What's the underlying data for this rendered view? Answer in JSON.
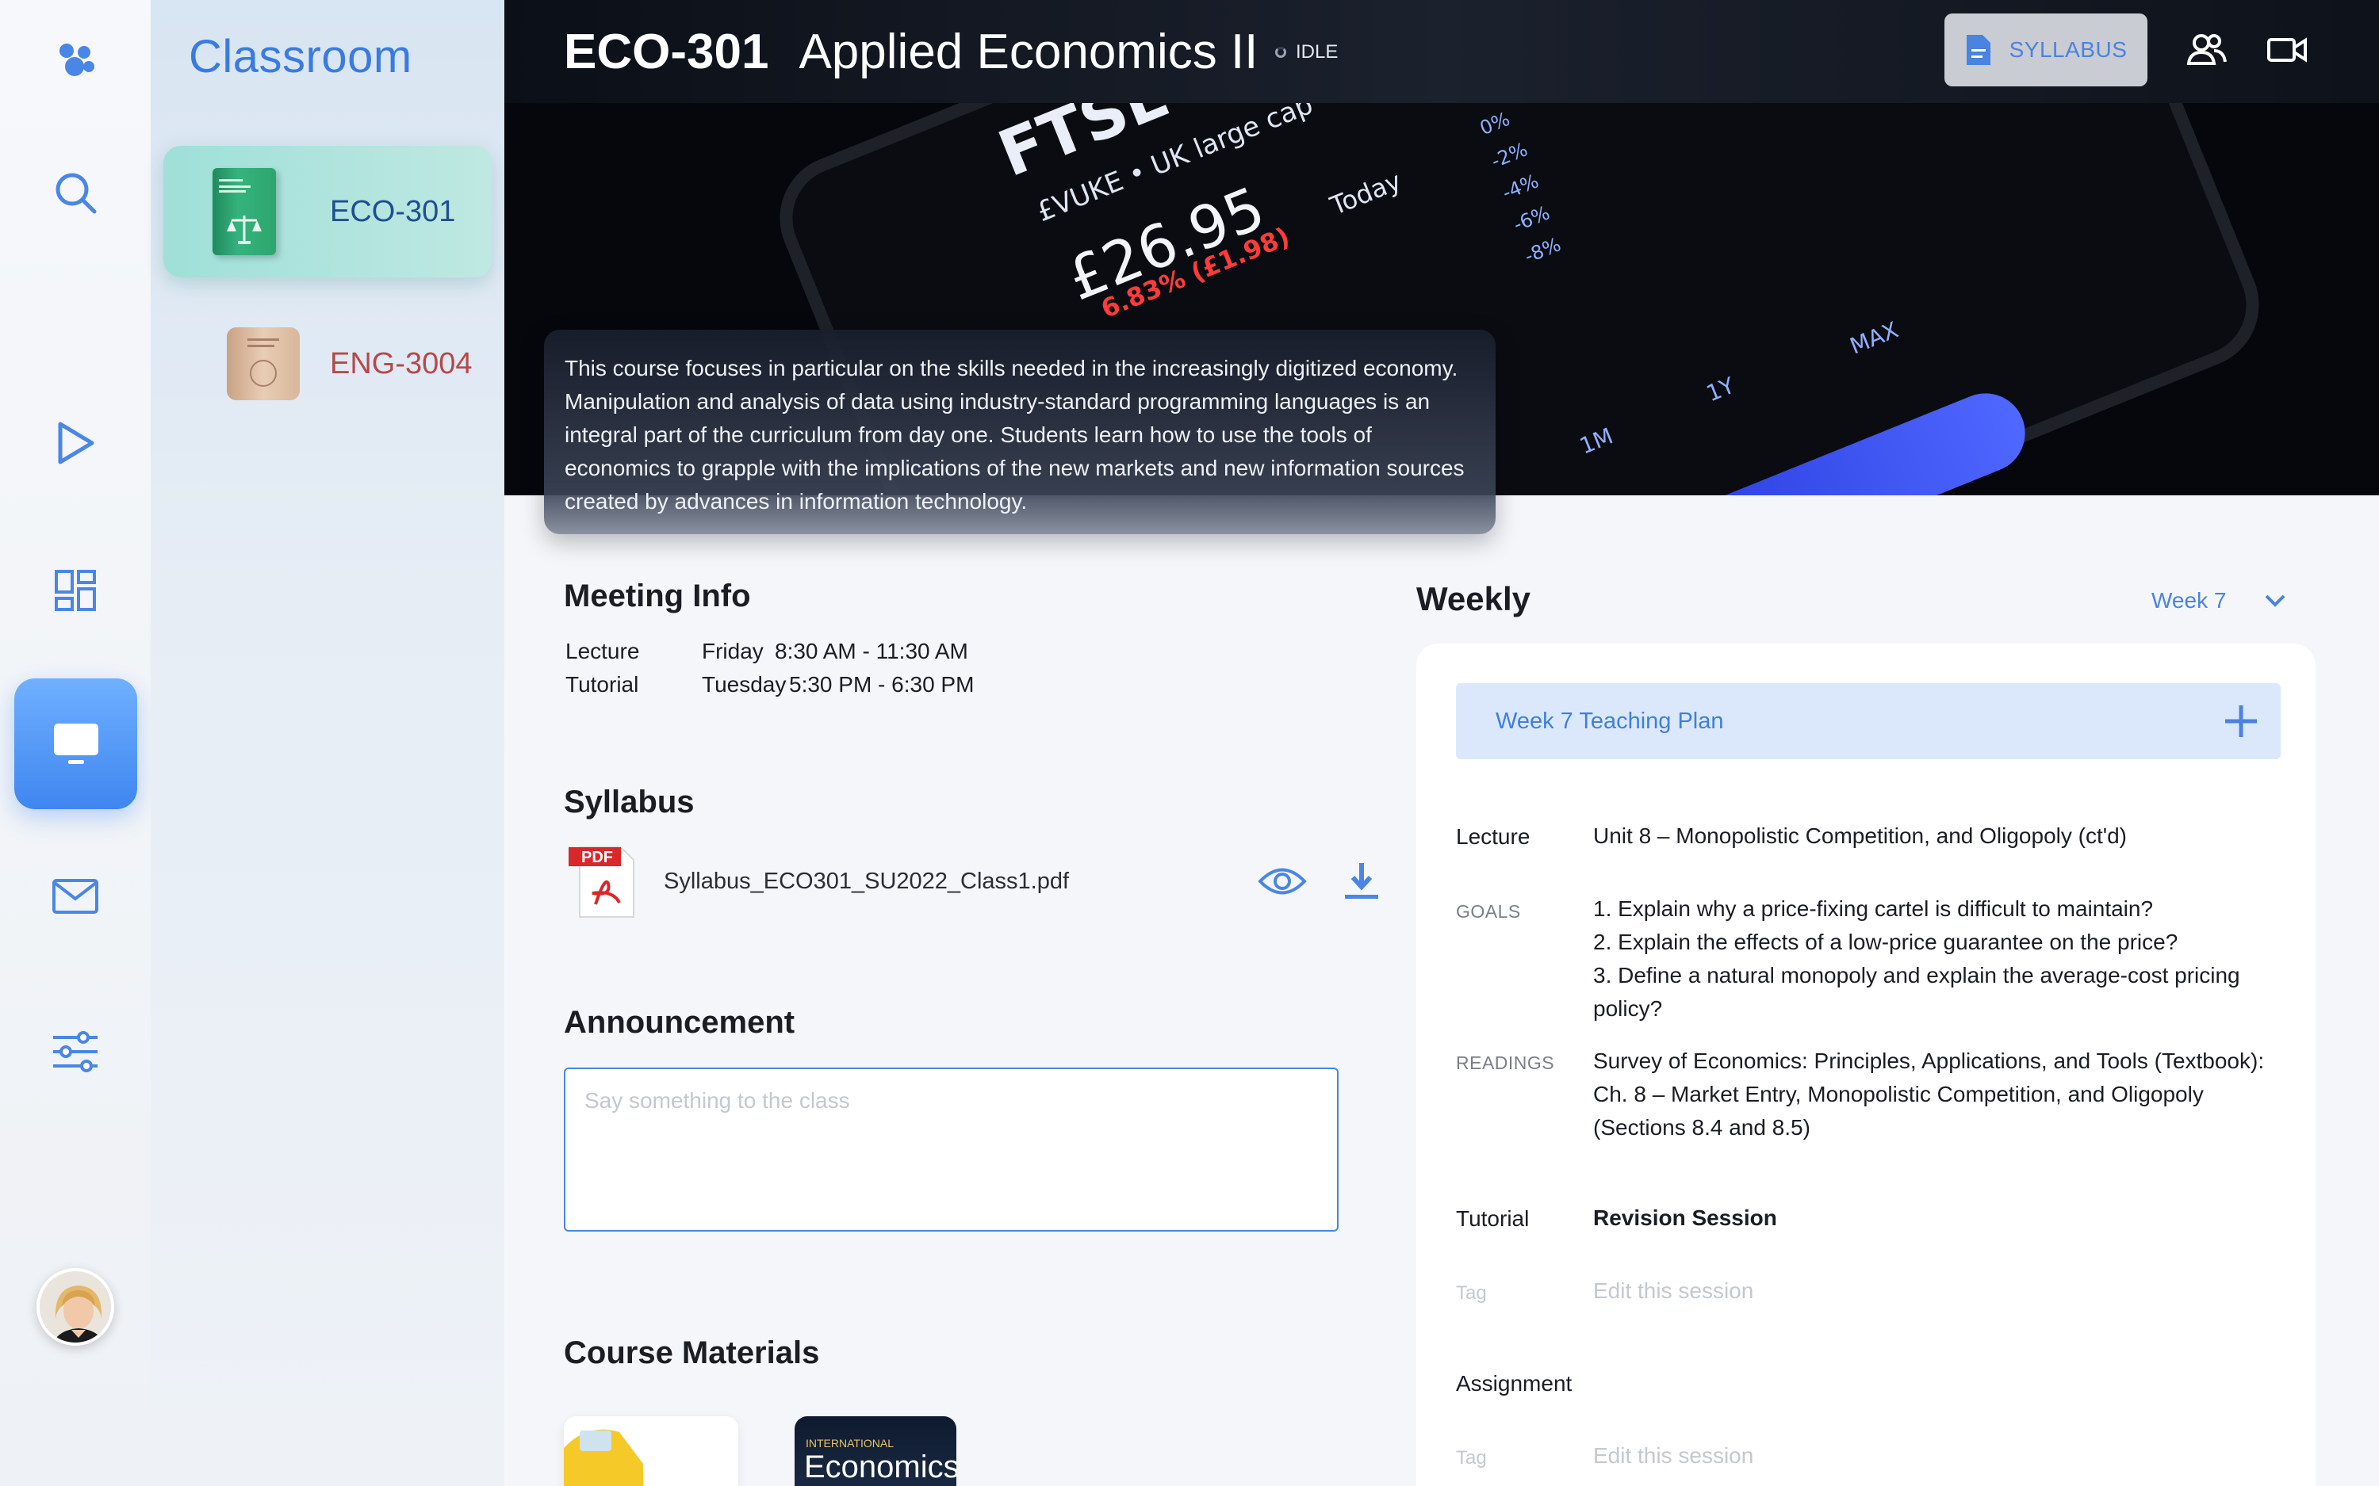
{
  "app": {
    "name": "Classroom"
  },
  "rail": {
    "items": [
      "logo-icon",
      "search-icon",
      "play-icon",
      "dashboard-icon",
      "classroom-icon",
      "mail-icon",
      "settings-sliders-icon"
    ],
    "active": "classroom-icon"
  },
  "courses": [
    {
      "code": "ECO-301",
      "active": true,
      "color": "#1f4f8f"
    },
    {
      "code": "ENG-3004",
      "active": false,
      "color": "#b44a4a"
    }
  ],
  "header": {
    "code": "ECO-301",
    "title": "Applied Economics II",
    "status": "IDLE",
    "syllabus_label": "SYLLABUS"
  },
  "hero": {
    "ticker_name": "FTSE",
    "ticker_sub": "£VUKE • UK large cap",
    "price": "£26.95",
    "change": "6.83% (£1.98)",
    "change_period": "Today",
    "percent_ticks": [
      "0%",
      "-2%",
      "-4%",
      "-6%",
      "-8%"
    ],
    "range_tabs": [
      "1M",
      "1Y",
      "MAX"
    ],
    "description": "This course focuses in particular on the skills needed in the increasingly digitized economy. Manipulation and analysis of data using industry-standard programming languages is an integral part of the curriculum from day one. Students learn how to use the tools of economics to grapple with the implications of the new markets and new information sources created by advances in information technology."
  },
  "meeting": {
    "title": "Meeting Info",
    "rows": [
      {
        "label": "Lecture",
        "day": "Friday",
        "time": "8:30 AM - 11:30 AM"
      },
      {
        "label": "Tutorial",
        "day": "Tuesday",
        "time": "5:30 PM - 6:30 PM"
      }
    ]
  },
  "syllabus": {
    "title": "Syllabus",
    "file_badge": "PDF",
    "file_name": "Syllabus_ECO301_SU2022_Class1.pdf"
  },
  "announcement": {
    "title": "Announcement",
    "placeholder": "Say something to the class"
  },
  "materials": {
    "title": "Course Materials",
    "book2_label_top": "INTERNATIONAL",
    "book2_label_main": "Economics"
  },
  "weekly": {
    "title": "Weekly",
    "selected_week": "Week 7",
    "plan_title": "Week 7 Teaching  Plan",
    "lecture_label": "Lecture",
    "lecture_title": "Unit 8 – Monopolistic Competition, and Oligopoly (ct'd)",
    "goals_label": "GOALS",
    "goals": [
      "1. Explain why a price-fixing cartel is difficult to maintain?",
      "2. Explain the effects of a low-price guarantee on the price?",
      "3. Define a natural monopoly and explain the average-cost pricing policy?"
    ],
    "readings_label": "READINGS",
    "readings": "Survey of Economics: Principles, Applications, and Tools (Textbook): Ch. 8 – Market Entry, Monopolistic Competition, and Oligopoly (Sections 8.4 and 8.5)",
    "tutorial_label": "Tutorial",
    "tutorial_title": "Revision Session",
    "tag_label": "Tag",
    "edit_placeholder": "Edit this session",
    "assignment_label": "Assignment"
  },
  "colors": {
    "accent": "#3f86f0",
    "brand_title": "#3a7be0",
    "hero_bg": "#05070c",
    "panel": "#ffffff"
  }
}
